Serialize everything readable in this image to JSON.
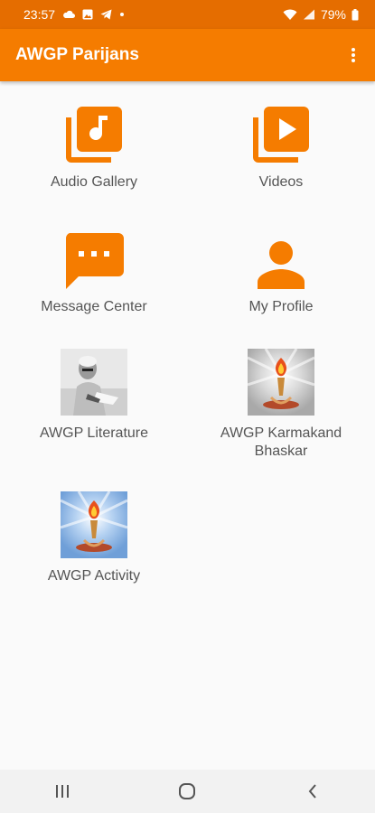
{
  "status_bar": {
    "time": "23:57",
    "battery": "79%",
    "icons": [
      "cloud-icon",
      "image-icon",
      "telegram-icon",
      "dot-icon",
      "wifi-icon",
      "signal-icon",
      "battery-icon"
    ]
  },
  "app_bar": {
    "title": "AWGP Parijans",
    "overflow_icon": "more-vert-icon"
  },
  "tiles": [
    {
      "label": "Audio Gallery",
      "icon": "audio-library-icon"
    },
    {
      "label": "Videos",
      "icon": "video-library-icon"
    },
    {
      "label": "Message Center",
      "icon": "message-icon"
    },
    {
      "label": "My Profile",
      "icon": "person-icon"
    },
    {
      "label": "AWGP Literature",
      "icon": "portrait-photo"
    },
    {
      "label": "AWGP Karmakand Bhaskar",
      "icon": "torch-emblem"
    },
    {
      "label": "AWGP Activity",
      "icon": "torch-emblem"
    }
  ],
  "nav_bar": {
    "buttons": [
      "recents-icon",
      "home-icon",
      "back-icon"
    ]
  },
  "colors": {
    "status_bar": "#e56d00",
    "app_bar": "#f57c00",
    "accent": "#f57c00",
    "background": "#fafafa",
    "label_text": "#555555"
  }
}
